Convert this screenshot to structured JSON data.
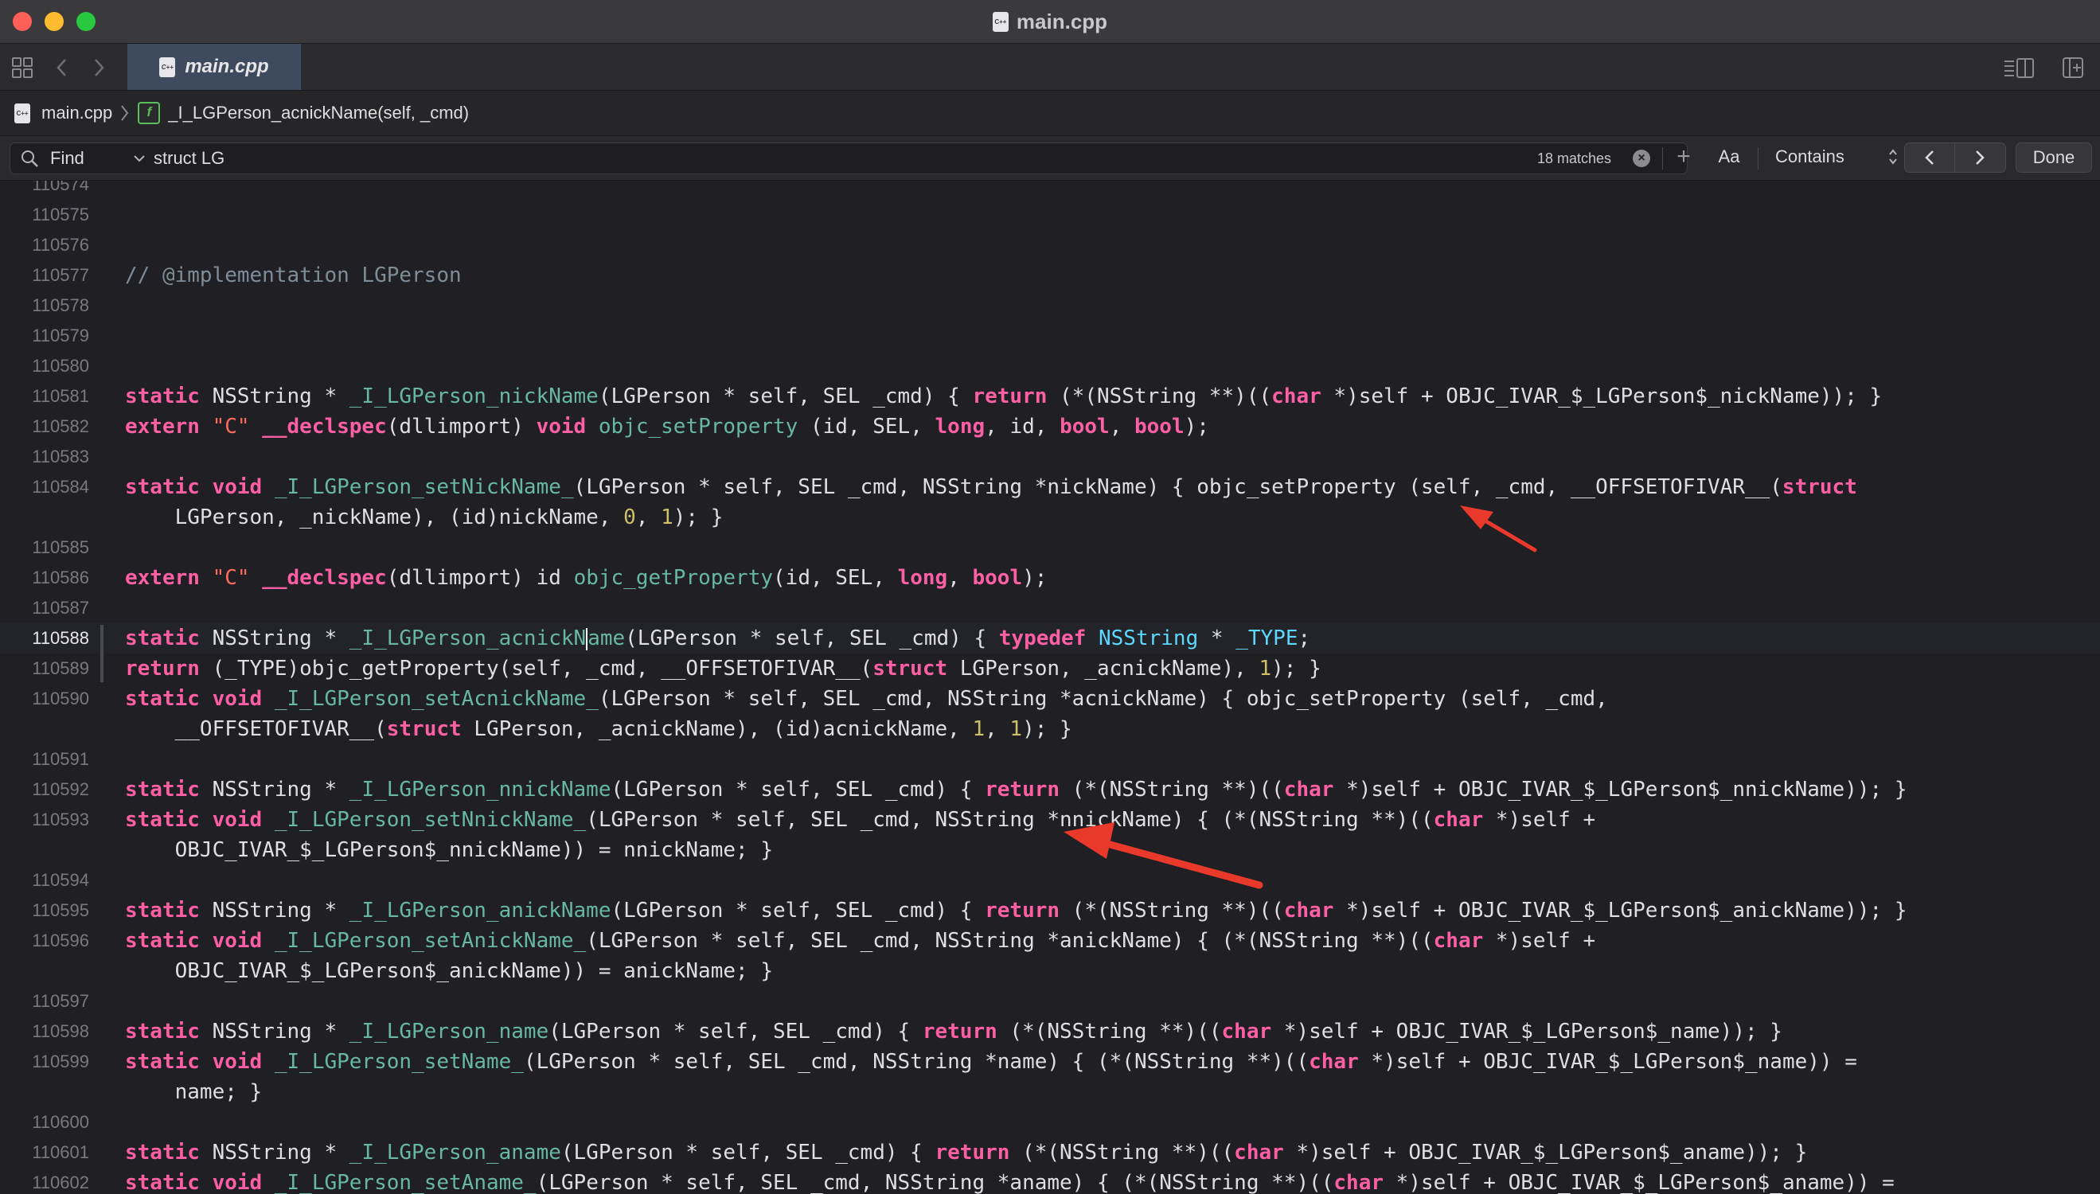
{
  "window": {
    "title": "main.cpp",
    "file_badge": "C++"
  },
  "tabs": [
    {
      "label": "main.cpp",
      "active": true
    }
  ],
  "breadcrumb": {
    "file": "main.cpp",
    "function_badge": "f",
    "function": "_I_LGPerson_acnickName(self, _cmd)"
  },
  "find": {
    "mode": "Find",
    "query": "struct LG",
    "matches": "18 matches",
    "case_toggle": "Aa",
    "match_type": "Contains",
    "done_label": "Done"
  },
  "icons": {
    "grid": "grid-icon",
    "back": "back-icon",
    "forward": "forward-icon",
    "search": "search-icon",
    "chevron": "chevron-down-icon",
    "clear": "clear-icon",
    "plus": "plus-icon",
    "prev": "chevron-left-icon",
    "next": "chevron-right-icon",
    "inspector": "inspector-icon",
    "add_editor": "add-editor-icon"
  },
  "colors": {
    "keyword": "#fc5fa3",
    "function": "#67b7a4",
    "type": "#5dd8ff",
    "string": "#fc6a5d",
    "number": "#d0bf69",
    "comment": "#7f8c98",
    "arrow": "#e8392b"
  },
  "code": {
    "lines": [
      {
        "n": "110574",
        "t": []
      },
      {
        "n": "110575",
        "t": []
      },
      {
        "n": "110576",
        "t": []
      },
      {
        "n": "110577",
        "t": [
          [
            "cm",
            "// @implementation LGPerson"
          ]
        ]
      },
      {
        "n": "110578",
        "t": []
      },
      {
        "n": "110579",
        "t": []
      },
      {
        "n": "110580",
        "t": []
      },
      {
        "n": "110581",
        "t": [
          [
            "kw",
            "static"
          ],
          [
            "p",
            " NSString * "
          ],
          [
            "fn",
            "_I_LGPerson_nickName"
          ],
          [
            "p",
            "(LGPerson * self, SEL _cmd) { "
          ],
          [
            "kw",
            "return"
          ],
          [
            "p",
            " (*(NSString **)(("
          ],
          [
            "kw",
            "char"
          ],
          [
            "p",
            " *)self + OBJC_IVAR_$_LGPerson$_nickName)); }"
          ]
        ]
      },
      {
        "n": "110582",
        "t": [
          [
            "kw",
            "extern"
          ],
          [
            "p",
            " "
          ],
          [
            "str",
            "\"C\""
          ],
          [
            "p",
            " "
          ],
          [
            "kw",
            "__declspec"
          ],
          [
            "p",
            "(dllimport) "
          ],
          [
            "kw",
            "void"
          ],
          [
            "p",
            " "
          ],
          [
            "fn",
            "objc_setProperty"
          ],
          [
            "p",
            " (id, SEL, "
          ],
          [
            "kw",
            "long"
          ],
          [
            "p",
            ", id, "
          ],
          [
            "kw",
            "bool"
          ],
          [
            "p",
            ", "
          ],
          [
            "kw",
            "bool"
          ],
          [
            "p",
            ");"
          ]
        ]
      },
      {
        "n": "110583",
        "t": []
      },
      {
        "n": "110584",
        "t": [
          [
            "kw",
            "static"
          ],
          [
            "p",
            " "
          ],
          [
            "kw",
            "void"
          ],
          [
            "p",
            " "
          ],
          [
            "fn",
            "_I_LGPerson_setNickName_"
          ],
          [
            "p",
            "(LGPerson * self, SEL _cmd, NSString *nickName) { objc_setProperty (self, _cmd, __OFFSETOFIVAR__("
          ],
          [
            "kw",
            "struct"
          ]
        ]
      },
      {
        "n": "",
        "t": [
          [
            "p",
            "    LGPerson, _nickName), (id)nickName, "
          ],
          [
            "num",
            "0"
          ],
          [
            "p",
            ", "
          ],
          [
            "num",
            "1"
          ],
          [
            "p",
            "); }"
          ]
        ]
      },
      {
        "n": "110585",
        "t": []
      },
      {
        "n": "110586",
        "t": [
          [
            "kw",
            "extern"
          ],
          [
            "p",
            " "
          ],
          [
            "str",
            "\"C\""
          ],
          [
            "p",
            " "
          ],
          [
            "kw",
            "__declspec"
          ],
          [
            "p",
            "(dllimport) id "
          ],
          [
            "fn",
            "objc_getProperty"
          ],
          [
            "p",
            "(id, SEL, "
          ],
          [
            "kw",
            "long"
          ],
          [
            "p",
            ", "
          ],
          [
            "kw",
            "bool"
          ],
          [
            "p",
            ");"
          ]
        ]
      },
      {
        "n": "110587",
        "t": []
      },
      {
        "n": "110588",
        "current": true,
        "t": [
          [
            "kw",
            "static"
          ],
          [
            "p",
            " NSString * "
          ],
          [
            "fn",
            "_I_LGPerson_acnickN"
          ],
          [
            "cursor",
            ""
          ],
          [
            "fn",
            "ame"
          ],
          [
            "p",
            "(LGPerson * self, SEL _cmd) { "
          ],
          [
            "kw",
            "typedef"
          ],
          [
            "p",
            " "
          ],
          [
            "ty",
            "NSString"
          ],
          [
            "p",
            " * "
          ],
          [
            "ty",
            "_TYPE"
          ],
          [
            "p",
            ";"
          ]
        ]
      },
      {
        "n": "110589",
        "t": [
          [
            "kw",
            "return"
          ],
          [
            "p",
            " (_TYPE)objc_getProperty(self, _cmd, __OFFSETOFIVAR__("
          ],
          [
            "kw",
            "struct"
          ],
          [
            "p",
            " LGPerson, _acnickName), "
          ],
          [
            "num",
            "1"
          ],
          [
            "p",
            "); }"
          ]
        ]
      },
      {
        "n": "110590",
        "t": [
          [
            "kw",
            "static"
          ],
          [
            "p",
            " "
          ],
          [
            "kw",
            "void"
          ],
          [
            "p",
            " "
          ],
          [
            "fn",
            "_I_LGPerson_setAcnickName_"
          ],
          [
            "p",
            "(LGPerson * self, SEL _cmd, NSString *acnickName) { objc_setProperty (self, _cmd,"
          ]
        ]
      },
      {
        "n": "",
        "t": [
          [
            "p",
            "    __OFFSETOFIVAR__("
          ],
          [
            "kw",
            "struct"
          ],
          [
            "p",
            " LGPerson, _acnickName), (id)acnickName, "
          ],
          [
            "num",
            "1"
          ],
          [
            "p",
            ", "
          ],
          [
            "num",
            "1"
          ],
          [
            "p",
            "); }"
          ]
        ]
      },
      {
        "n": "110591",
        "t": []
      },
      {
        "n": "110592",
        "t": [
          [
            "kw",
            "static"
          ],
          [
            "p",
            " NSString * "
          ],
          [
            "fn",
            "_I_LGPerson_nnickName"
          ],
          [
            "p",
            "(LGPerson * self, SEL _cmd) { "
          ],
          [
            "kw",
            "return"
          ],
          [
            "p",
            " (*(NSString **)(("
          ],
          [
            "kw",
            "char"
          ],
          [
            "p",
            " *)self + OBJC_IVAR_$_LGPerson$_nnickName)); }"
          ]
        ]
      },
      {
        "n": "110593",
        "t": [
          [
            "kw",
            "static"
          ],
          [
            "p",
            " "
          ],
          [
            "kw",
            "void"
          ],
          [
            "p",
            " "
          ],
          [
            "fn",
            "_I_LGPerson_setNnickName_"
          ],
          [
            "p",
            "(LGPerson * self, SEL _cmd, NSString *nnickName) { (*(NSString **)(("
          ],
          [
            "kw",
            "char"
          ],
          [
            "p",
            " *)self +"
          ]
        ]
      },
      {
        "n": "",
        "t": [
          [
            "p",
            "    OBJC_IVAR_$_LGPerson$_nnickName)) = nnickName; }"
          ]
        ]
      },
      {
        "n": "110594",
        "t": []
      },
      {
        "n": "110595",
        "t": [
          [
            "kw",
            "static"
          ],
          [
            "p",
            " NSString * "
          ],
          [
            "fn",
            "_I_LGPerson_anickName"
          ],
          [
            "p",
            "(LGPerson * self, SEL _cmd) { "
          ],
          [
            "kw",
            "return"
          ],
          [
            "p",
            " (*(NSString **)(("
          ],
          [
            "kw",
            "char"
          ],
          [
            "p",
            " *)self + OBJC_IVAR_$_LGPerson$_anickName)); }"
          ]
        ]
      },
      {
        "n": "110596",
        "t": [
          [
            "kw",
            "static"
          ],
          [
            "p",
            " "
          ],
          [
            "kw",
            "void"
          ],
          [
            "p",
            " "
          ],
          [
            "fn",
            "_I_LGPerson_setAnickName_"
          ],
          [
            "p",
            "(LGPerson * self, SEL _cmd, NSString *anickName) { (*(NSString **)(("
          ],
          [
            "kw",
            "char"
          ],
          [
            "p",
            " *)self +"
          ]
        ]
      },
      {
        "n": "",
        "t": [
          [
            "p",
            "    OBJC_IVAR_$_LGPerson$_anickName)) = anickName; }"
          ]
        ]
      },
      {
        "n": "110597",
        "t": []
      },
      {
        "n": "110598",
        "t": [
          [
            "kw",
            "static"
          ],
          [
            "p",
            " NSString * "
          ],
          [
            "fn",
            "_I_LGPerson_name"
          ],
          [
            "p",
            "(LGPerson * self, SEL _cmd) { "
          ],
          [
            "kw",
            "return"
          ],
          [
            "p",
            " (*(NSString **)(("
          ],
          [
            "kw",
            "char"
          ],
          [
            "p",
            " *)self + OBJC_IVAR_$_LGPerson$_name)); }"
          ]
        ]
      },
      {
        "n": "110599",
        "t": [
          [
            "kw",
            "static"
          ],
          [
            "p",
            " "
          ],
          [
            "kw",
            "void"
          ],
          [
            "p",
            " "
          ],
          [
            "fn",
            "_I_LGPerson_setName_"
          ],
          [
            "p",
            "(LGPerson * self, SEL _cmd, NSString *name) { (*(NSString **)(("
          ],
          [
            "kw",
            "char"
          ],
          [
            "p",
            " *)self + OBJC_IVAR_$_LGPerson$_name)) ="
          ]
        ]
      },
      {
        "n": "",
        "t": [
          [
            "p",
            "    name; }"
          ]
        ]
      },
      {
        "n": "110600",
        "t": []
      },
      {
        "n": "110601",
        "t": [
          [
            "kw",
            "static"
          ],
          [
            "p",
            " NSString * "
          ],
          [
            "fn",
            "_I_LGPerson_aname"
          ],
          [
            "p",
            "(LGPerson * self, SEL _cmd) { "
          ],
          [
            "kw",
            "return"
          ],
          [
            "p",
            " (*(NSString **)(("
          ],
          [
            "kw",
            "char"
          ],
          [
            "p",
            " *)self + OBJC_IVAR_$_LGPerson$_aname)); }"
          ]
        ]
      },
      {
        "n": "110602",
        "t": [
          [
            "kw",
            "static"
          ],
          [
            "p",
            " "
          ],
          [
            "kw",
            "void"
          ],
          [
            "p",
            " "
          ],
          [
            "fn",
            "_I_LGPerson_setAname_"
          ],
          [
            "p",
            "(LGPerson * self, SEL _cmd, NSString *aname) { (*(NSString **)(("
          ],
          [
            "kw",
            "char"
          ],
          [
            "p",
            " *)self + OBJC_IVAR_$_LGPerson$_aname)) ="
          ]
        ]
      }
    ]
  }
}
